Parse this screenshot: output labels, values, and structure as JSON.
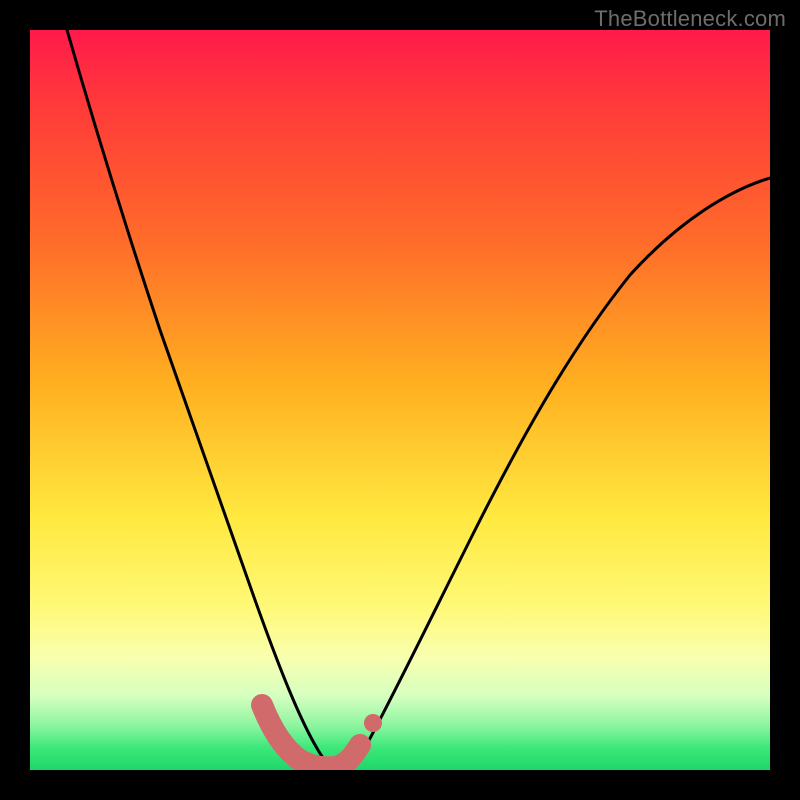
{
  "watermark": "TheBottleneck.com",
  "chart_data": {
    "type": "line",
    "title": "",
    "xlabel": "",
    "ylabel": "",
    "xlim": [
      0,
      100
    ],
    "ylim": [
      0,
      100
    ],
    "annotations": [],
    "series": [
      {
        "name": "bottleneck-curve",
        "x": [
          5,
          10,
          15,
          20,
          25,
          28,
          30,
          32,
          34,
          36,
          38,
          40,
          42,
          45,
          50,
          55,
          60,
          65,
          70,
          75,
          80,
          85,
          90,
          95,
          100
        ],
        "values": [
          100,
          86,
          72,
          57,
          41,
          30,
          22,
          14,
          7,
          3,
          1,
          0,
          1,
          4,
          12,
          22,
          32,
          41,
          49,
          56,
          62,
          68,
          73,
          77,
          80
        ]
      },
      {
        "name": "highlight-band",
        "x": [
          31.5,
          33,
          35,
          37,
          39,
          40,
          41,
          42.5
        ],
        "values": [
          8.5,
          4,
          1.5,
          0.7,
          0.7,
          0.8,
          1.2,
          3.0
        ]
      },
      {
        "name": "highlight-dot",
        "x": [
          44.5
        ],
        "values": [
          6.5
        ]
      }
    ],
    "background_gradient": {
      "top": "#ff1a4b",
      "upper_mid": "#ffb020",
      "mid": "#ffe940",
      "lower_mid": "#f8ffb0",
      "bottom": "#1fd66a"
    },
    "curve_color": "#000000",
    "highlight_color": "#d16a6a"
  }
}
